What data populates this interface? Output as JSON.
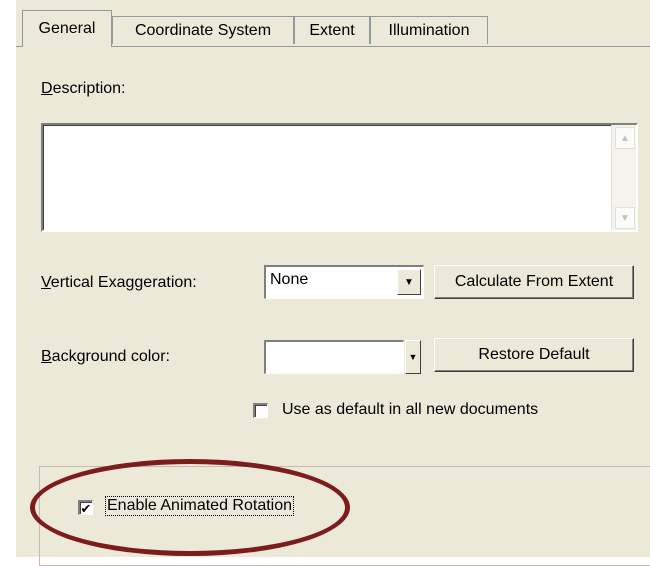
{
  "tabs": [
    {
      "label": "General",
      "active": true
    },
    {
      "label": "Coordinate System",
      "active": false
    },
    {
      "label": "Extent",
      "active": false
    },
    {
      "label": "Illumination",
      "active": false
    }
  ],
  "description": {
    "label_mnemonic": "D",
    "label_rest": "escription:",
    "value": ""
  },
  "vertical_exaggeration": {
    "label_mnemonic": "V",
    "label_rest": "ertical Exaggeration:",
    "selected": "None",
    "calc_button": "Calculate From Extent"
  },
  "background_color": {
    "label_mnemonic": "B",
    "label_rest": "ackground color:",
    "value": "#ffffff",
    "restore_button": "Restore Default",
    "use_default_checked": false,
    "use_default_label": "Use as default in all new documents"
  },
  "animated_rotation": {
    "checked": true,
    "check_glyph": "✔",
    "label": "Enable Animated Rotation",
    "highlight_color": "#7c1c1d"
  },
  "icons": {
    "scroll_up": "▲",
    "scroll_down": "▼",
    "dropdown": "▼"
  }
}
